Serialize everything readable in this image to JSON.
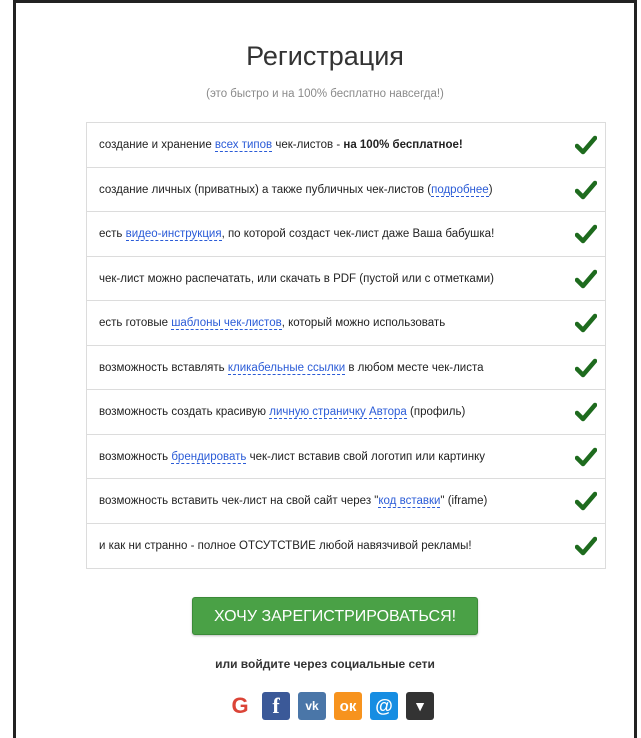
{
  "header": {
    "title": "Регистрация",
    "subtitle": "(это быстро и на 100% бесплатно навсегда!)"
  },
  "features": [
    {
      "parts": [
        {
          "t": "создание и хранение "
        },
        {
          "t": "всех типов",
          "link": true
        },
        {
          "t": " чек-листов - "
        },
        {
          "t": "на 100% бесплатное!",
          "bold": true
        }
      ]
    },
    {
      "parts": [
        {
          "t": "создание личных (приватных) а также публичных чек-листов ("
        },
        {
          "t": "подробнее",
          "link": true
        },
        {
          "t": ")"
        }
      ]
    },
    {
      "parts": [
        {
          "t": "есть "
        },
        {
          "t": "видео-инструкция",
          "link": true
        },
        {
          "t": ", по которой создаст чек-лист даже Ваша бабушка!"
        }
      ]
    },
    {
      "parts": [
        {
          "t": "чек-лист можно распечатать, или скачать в PDF (пустой или с отметками)"
        }
      ]
    },
    {
      "parts": [
        {
          "t": "есть готовые "
        },
        {
          "t": "шаблоны чек-листов",
          "link": true
        },
        {
          "t": ", который можно использовать"
        }
      ]
    },
    {
      "parts": [
        {
          "t": "возможность вставлять "
        },
        {
          "t": "кликабельные ссылки",
          "link": true
        },
        {
          "t": " в любом месте чек-листа"
        }
      ]
    },
    {
      "parts": [
        {
          "t": "возможность создать красивую "
        },
        {
          "t": "личную страничку Автора",
          "link": true
        },
        {
          "t": " (профиль)"
        }
      ]
    },
    {
      "parts": [
        {
          "t": "возможность "
        },
        {
          "t": "брендировать",
          "link": true
        },
        {
          "t": " чек-лист вставив свой логотип или картинку"
        }
      ]
    },
    {
      "parts": [
        {
          "t": "возможность вставить чек-лист на свой сайт через \""
        },
        {
          "t": "код вставки",
          "link": true
        },
        {
          "t": "\" (iframe)"
        }
      ]
    },
    {
      "parts": [
        {
          "t": "и как ни странно - полное ОТСУТСТВИЕ любой навязчивой рекламы!"
        }
      ]
    }
  ],
  "colors": {
    "check": "#1e6b1e",
    "cta": "#4aa146",
    "link": "#2a5bd7"
  },
  "cta": {
    "label": "ХОЧУ ЗАРЕГИСТРИРОВАТЬСЯ!"
  },
  "social": {
    "label": "или войдите через социальные сети",
    "buttons": [
      {
        "name": "google-login-button",
        "icon": "google-icon",
        "glyph": "G",
        "cls": "soc-g"
      },
      {
        "name": "facebook-login-button",
        "icon": "facebook-icon",
        "glyph": "f",
        "cls": "soc-fb"
      },
      {
        "name": "vk-login-button",
        "icon": "vk-icon",
        "glyph": "vk",
        "cls": "soc-vk"
      },
      {
        "name": "odnoklassniki-login-button",
        "icon": "odnoklassniki-icon",
        "glyph": "ок",
        "cls": "soc-ok"
      },
      {
        "name": "mailru-login-button",
        "icon": "mailru-icon",
        "glyph": "@",
        "cls": "soc-mail"
      },
      {
        "name": "more-login-button",
        "icon": "chevron-down-icon",
        "glyph": "▼",
        "cls": "soc-more"
      }
    ]
  }
}
